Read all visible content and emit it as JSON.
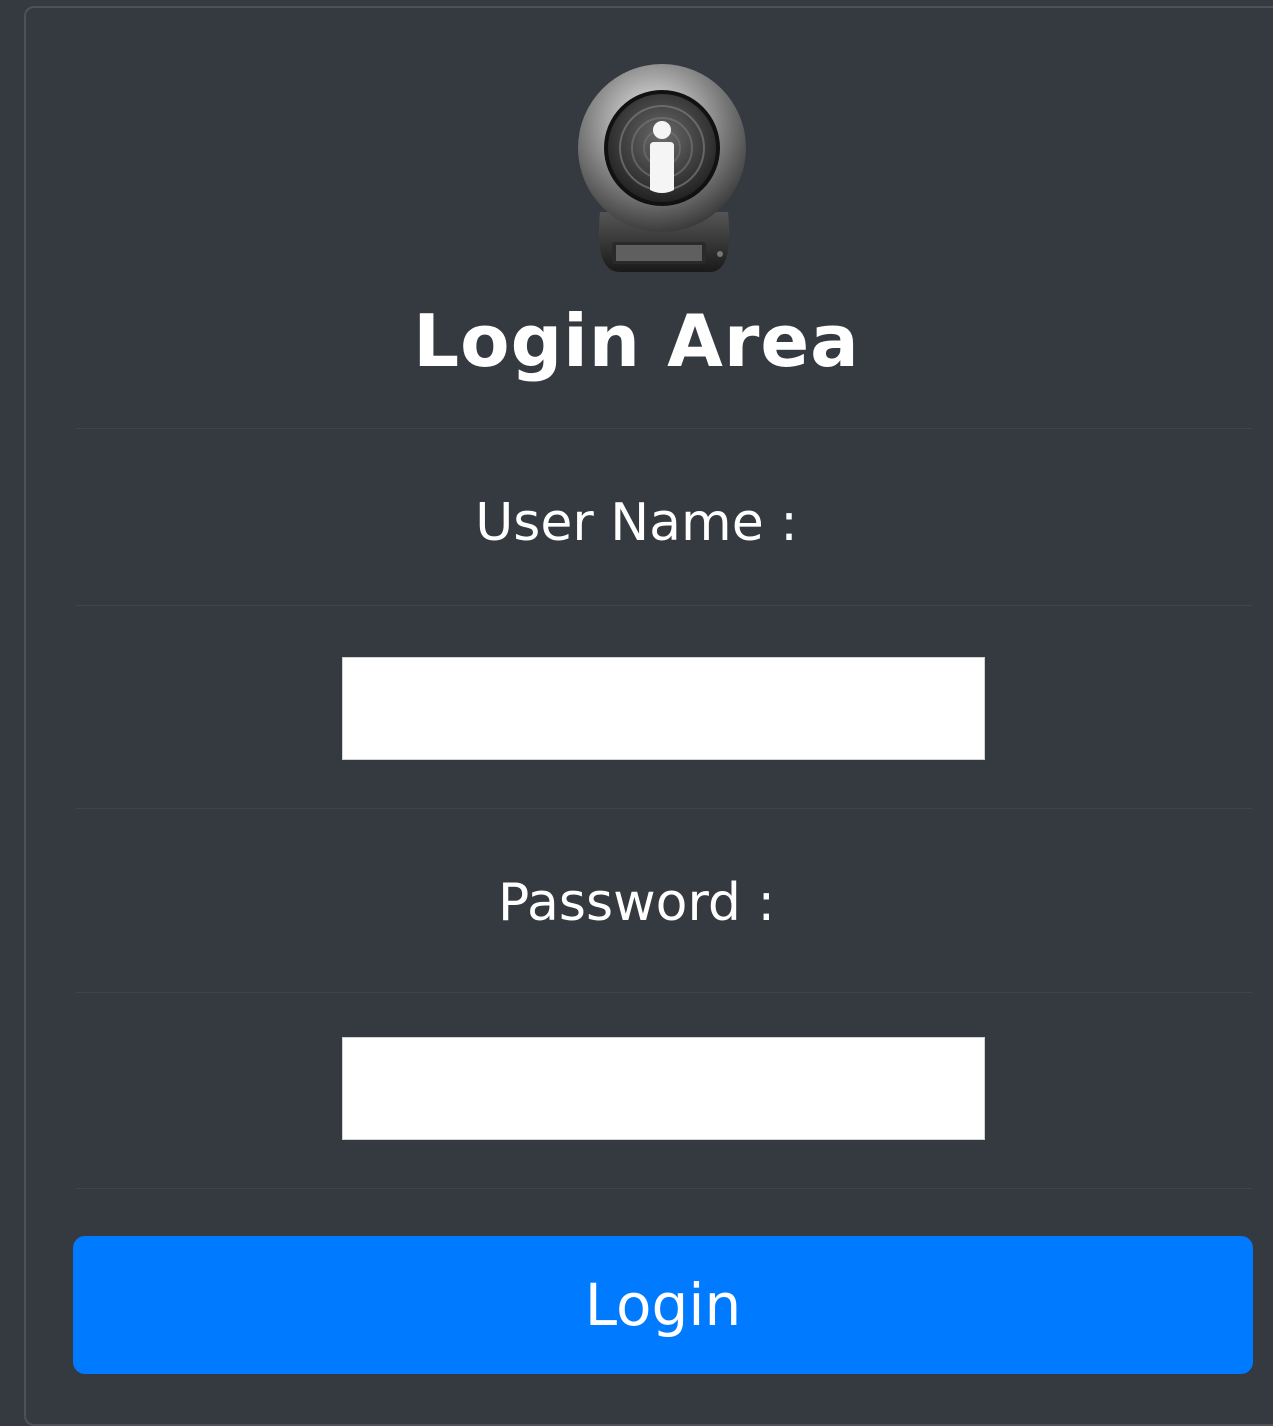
{
  "login_form": {
    "title": "Login Area",
    "logo_icon": "drive-lock-icon",
    "username_label": "User Name :",
    "username_value": "",
    "password_label": "Password  :",
    "password_value": "",
    "login_button_label": "Login"
  },
  "colors": {
    "background": "#343a40",
    "input_background": "#ffffff",
    "button": "#007bff",
    "text": "#ffffff"
  }
}
